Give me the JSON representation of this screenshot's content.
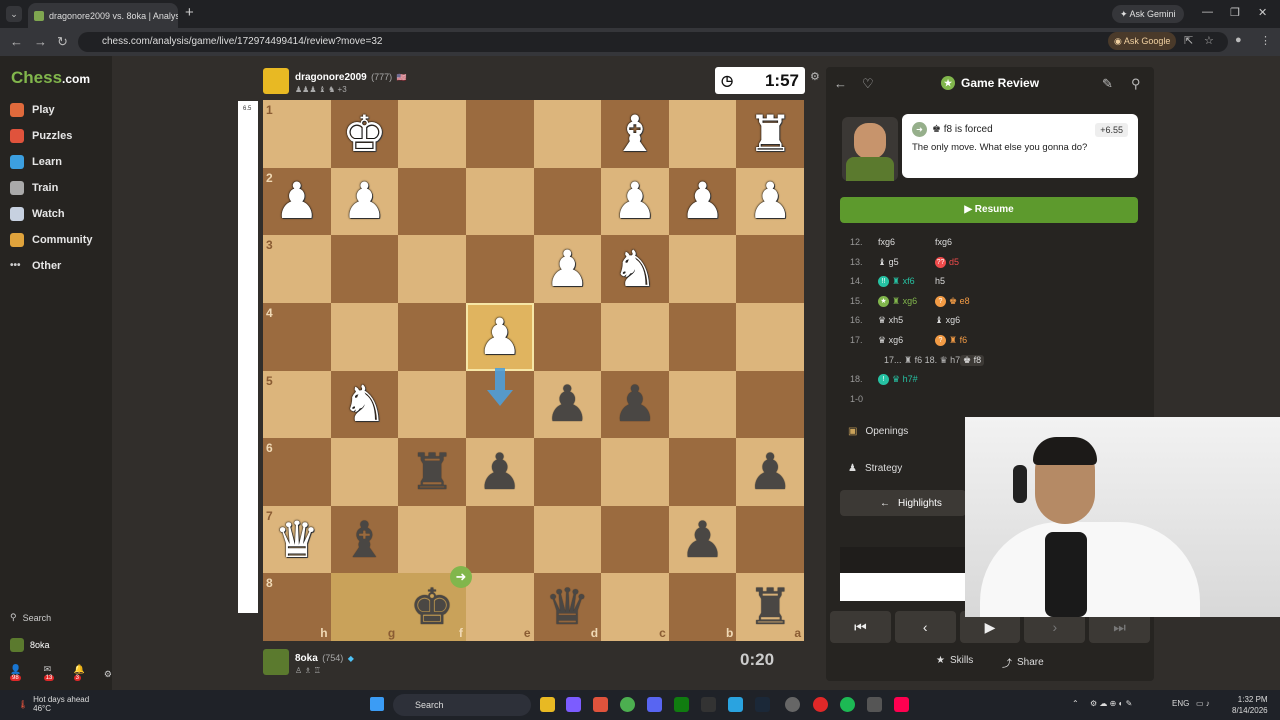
{
  "browser": {
    "tab_title": "dragonore2009 vs. 8oka | Analysis",
    "url": "chess.com/analysis/game/live/172974499414/review?move=32",
    "ask_gemini": "Ask Gemini",
    "ask_google": "Ask Google"
  },
  "sidebar": {
    "logo_a": "Chess",
    "logo_b": ".com",
    "items": [
      {
        "label": "Play",
        "icon": "play-icon",
        "color": "#e06a3c"
      },
      {
        "label": "Puzzles",
        "icon": "puzzles-icon",
        "color": "#e0533c"
      },
      {
        "label": "Learn",
        "icon": "learn-icon",
        "color": "#3c9fe0"
      },
      {
        "label": "Train",
        "icon": "train-icon",
        "color": "#aaaaaa"
      },
      {
        "label": "Watch",
        "icon": "watch-icon",
        "color": "#c7d1e0"
      },
      {
        "label": "Community",
        "icon": "community-icon",
        "color": "#e0a33c"
      },
      {
        "label": "Other",
        "icon": "more-icon",
        "color": "#cccccc"
      }
    ],
    "search": "Search",
    "username": "8oka",
    "badges": {
      "friends": "98",
      "messages": "13",
      "notifications": "3"
    }
  },
  "top_player": {
    "name": "dragonore2009",
    "rating": "(777)",
    "extra": "+3",
    "clock": "1:57"
  },
  "bottom_player": {
    "name": "8oka",
    "rating": "(754)",
    "clock": "0:20"
  },
  "eval_bar_label": "6.5",
  "board": {
    "ranks": [
      "1",
      "2",
      "3",
      "4",
      "5",
      "6",
      "7",
      "8"
    ],
    "files": [
      "h",
      "g",
      "f",
      "e",
      "d",
      "c",
      "b",
      "a"
    ],
    "pieces": [
      [
        "",
        "wK",
        "",
        "",
        "",
        "wB",
        "",
        "wR"
      ],
      [
        "wP",
        "wP",
        "",
        "",
        "",
        "wP",
        "wP",
        "wP"
      ],
      [
        "",
        "",
        "",
        "",
        "wP",
        "wN",
        "",
        ""
      ],
      [
        "",
        "",
        "",
        "wP",
        "",
        "",
        "",
        ""
      ],
      [
        "",
        "wN",
        "",
        "",
        "bP",
        "bP",
        "",
        ""
      ],
      [
        "",
        "",
        "bR",
        "bP",
        "",
        "",
        "",
        "bP"
      ],
      [
        "wQ",
        "bB",
        "",
        "",
        "",
        "",
        "bP",
        ""
      ],
      [
        "",
        "",
        "bK",
        "",
        "bQ",
        "",
        "",
        "bR"
      ]
    ]
  },
  "review": {
    "title": "Game Review",
    "move_text": "♚ f8 is forced",
    "eval": "+6.55",
    "comment": "The only move. What else you gonna do?",
    "resume": "Resume",
    "moves": [
      {
        "n": "12.",
        "w": "fxg6",
        "b": "fxg6"
      },
      {
        "n": "13.",
        "w": "♝ g5",
        "b": "d5",
        "bb": "??",
        "bclass": "bcol"
      },
      {
        "n": "14.",
        "w": "♜ xf6",
        "wb": "!!",
        "wclass": "scol",
        "b": "h5"
      },
      {
        "n": "15.",
        "w": "♜ xg6",
        "wb": "★",
        "wclass": "gcol",
        "b": "♚ e8",
        "bb": "?",
        "bclass": "ccol"
      },
      {
        "n": "16.",
        "w": "♛ xh5",
        "b": "♝ xg6"
      },
      {
        "n": "17.",
        "w": "♛ xg6",
        "b": "♜ f6",
        "bb": "?",
        "bclass": "ccol"
      },
      {
        "n": "",
        "w": "17... ♜ f6  18. ♛ h7+",
        "b": "♚ f8"
      },
      {
        "n": "18.",
        "w": "♛ h7#",
        "wb": "!",
        "wclass": "scol",
        "b": ""
      },
      {
        "n": "1-0",
        "w": "",
        "b": ""
      }
    ],
    "openings": "Openings",
    "strategy": "Strategy",
    "highlights": "Highlights",
    "skills": "Skills",
    "share": "Share"
  },
  "taskbar": {
    "weather": "Hot days ahead",
    "temp": "46°C",
    "search": "Search",
    "lang": "ENG",
    "time": "1:32 PM",
    "date": "8/14/2026"
  }
}
